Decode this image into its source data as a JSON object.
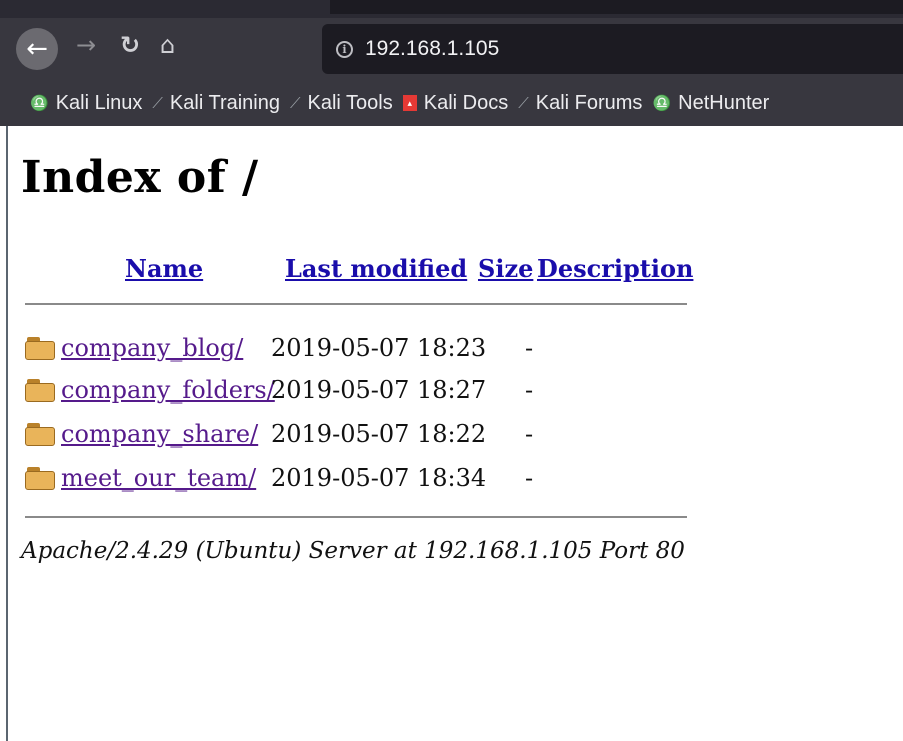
{
  "browser": {
    "url": "192.168.1.105",
    "bookmarks": [
      {
        "label": "Kali Linux",
        "icon": "kali-dragon-icon"
      },
      {
        "label": "Kali Training",
        "icon": "kali-dragon-icon"
      },
      {
        "label": "Kali Tools",
        "icon": "kali-dragon-icon"
      },
      {
        "label": "Kali Docs",
        "icon": "kali-docs-icon"
      },
      {
        "label": "Kali Forums",
        "icon": "kali-dragon-icon"
      },
      {
        "label": "NetHunter",
        "icon": "nethunter-icon"
      }
    ]
  },
  "page": {
    "title": "Index of /",
    "columns": {
      "name": "Name",
      "last_modified": "Last modified",
      "size": "Size",
      "description": "Description"
    },
    "entries": [
      {
        "name": "company_blog/",
        "modified": "2019-05-07 18:23",
        "size": "-"
      },
      {
        "name": "company_folders/",
        "modified": "2019-05-07 18:27",
        "size": "-"
      },
      {
        "name": "company_share/",
        "modified": "2019-05-07 18:22",
        "size": "-"
      },
      {
        "name": "meet_our_team/",
        "modified": "2019-05-07 18:34",
        "size": "-"
      }
    ],
    "footer": "Apache/2.4.29 (Ubuntu) Server at 192.168.1.105 Port 80"
  }
}
